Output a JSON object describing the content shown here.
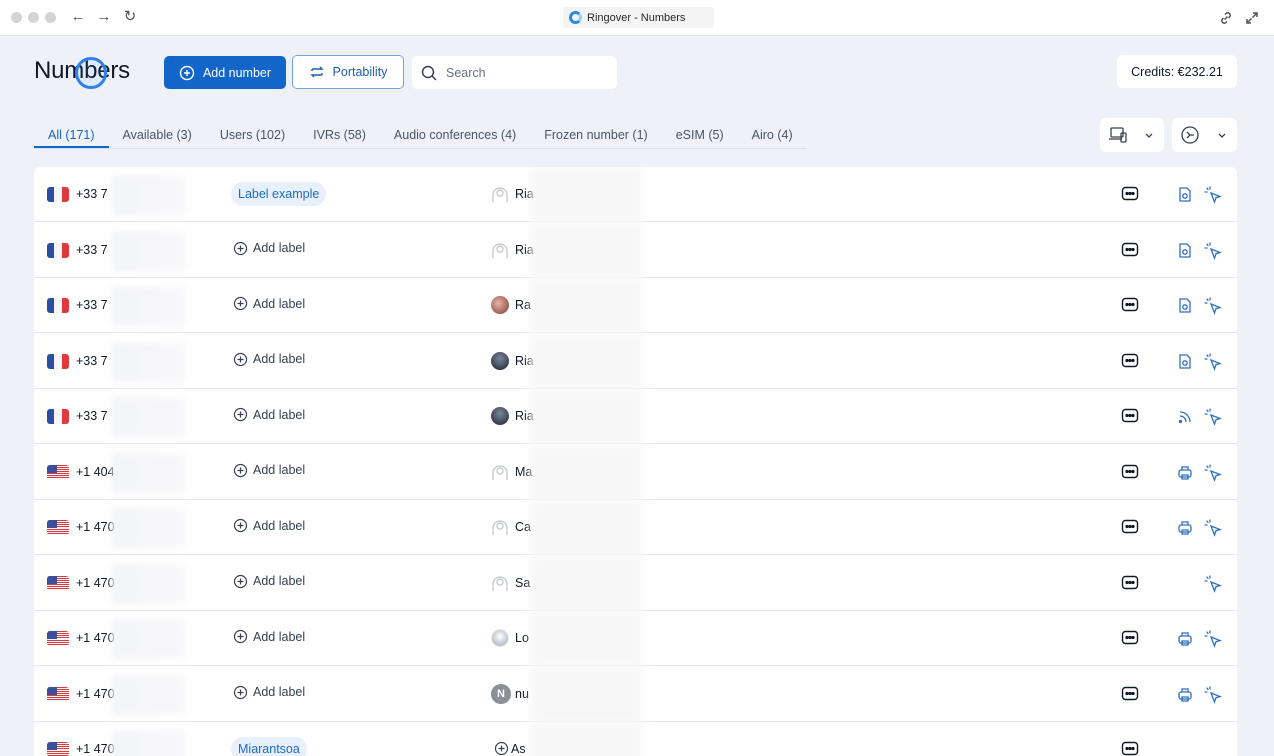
{
  "window": {
    "tab_title": "Ringover - Numbers"
  },
  "header": {
    "title": "Numbers",
    "add_number_label": "Add number",
    "portability_label": "Portability",
    "search_placeholder": "Search",
    "credits": "Credits: €232.21"
  },
  "tabs": [
    {
      "label": "All (171)",
      "active": true
    },
    {
      "label": "Available (3)",
      "active": false
    },
    {
      "label": "Users (102)",
      "active": false
    },
    {
      "label": "IVRs (58)",
      "active": false
    },
    {
      "label": "Audio conferences (4)",
      "active": false
    },
    {
      "label": "Frozen number (1)",
      "active": false
    },
    {
      "label": "eSIM (5)",
      "active": false
    },
    {
      "label": "Airo (4)",
      "active": false
    }
  ],
  "rows": [
    {
      "flag": "fr",
      "number": "+33 7",
      "label": "Label example",
      "has_label": true,
      "avatar": "placeholder",
      "owner": "Ria",
      "type_icon": "voicemail-doc-icon"
    },
    {
      "flag": "fr",
      "number": "+33 7",
      "label": "Add label",
      "has_label": false,
      "avatar": "placeholder",
      "owner": "Ria",
      "type_icon": "voicemail-doc-icon"
    },
    {
      "flag": "fr",
      "number": "+33 7",
      "label": "Add label",
      "has_label": false,
      "avatar": "photo",
      "owner": "Ra",
      "type_icon": "voicemail-doc-icon"
    },
    {
      "flag": "fr",
      "number": "+33 7",
      "label": "Add label",
      "has_label": false,
      "avatar": "photo-dark",
      "owner": "Ria",
      "type_icon": "voicemail-doc-icon"
    },
    {
      "flag": "fr",
      "number": "+33 7",
      "label": "Add label",
      "has_label": false,
      "avatar": "photo-dark",
      "owner": "Ria",
      "type_icon": "rss-icon"
    },
    {
      "flag": "us",
      "number": "+1 404",
      "label": "Add label",
      "has_label": false,
      "avatar": "placeholder",
      "owner": "Ma",
      "type_icon": "fax-icon"
    },
    {
      "flag": "us",
      "number": "+1 470",
      "label": "Add label",
      "has_label": false,
      "avatar": "placeholder",
      "owner": "Ca",
      "type_icon": "fax-icon"
    },
    {
      "flag": "us",
      "number": "+1 470",
      "label": "Add label",
      "has_label": false,
      "avatar": "placeholder",
      "owner": "Sa",
      "type_icon": ""
    },
    {
      "flag": "us",
      "number": "+1 470",
      "label": "Add label",
      "has_label": false,
      "avatar": "photo-light",
      "owner": "Lo",
      "type_icon": "fax-icon"
    },
    {
      "flag": "us",
      "number": "+1 470",
      "label": "Add label",
      "has_label": false,
      "avatar": "initial",
      "avatar_initial": "N",
      "owner": "nu",
      "type_icon": "fax-icon"
    },
    {
      "flag": "us",
      "number": "+1 470",
      "label": "Miarantsoa",
      "has_label": true,
      "avatar": "add",
      "owner": "As",
      "type_icon": ""
    }
  ],
  "colors": {
    "accent": "#1266c9",
    "icon_blue": "#2f6fc0",
    "background": "#eef2f8"
  }
}
